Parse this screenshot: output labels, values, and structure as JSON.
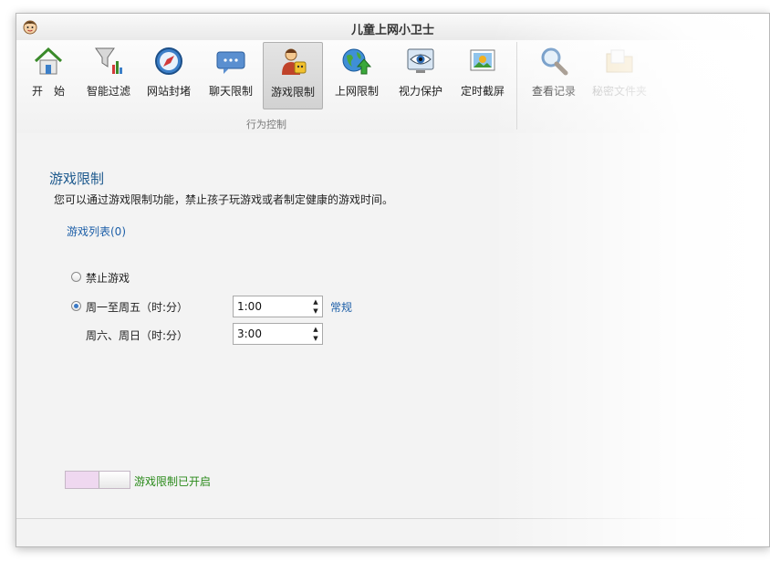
{
  "window": {
    "title": "儿童上网小卫士"
  },
  "ribbon": {
    "buttons": [
      {
        "label": "开　始",
        "icon": "house-icon"
      },
      {
        "label": "智能过滤",
        "icon": "funnel-chart-icon"
      },
      {
        "label": "网站封堵",
        "icon": "compass-icon"
      },
      {
        "label": "聊天限制",
        "icon": "chat-bubble-icon"
      },
      {
        "label": "游戏限制",
        "icon": "gamer-icon",
        "active": true
      },
      {
        "label": "上网限制",
        "icon": "globe-arrow-icon"
      },
      {
        "label": "视力保护",
        "icon": "eye-monitor-icon"
      },
      {
        "label": "定时截屏",
        "icon": "picture-icon"
      },
      {
        "label": "查看记录",
        "icon": "magnifier-icon"
      },
      {
        "label": "秘密文件夹",
        "icon": "folder-icon"
      }
    ],
    "group_label": "行为控制"
  },
  "content": {
    "title": "游戏限制",
    "description": "您可以通过游戏限制功能，禁止孩子玩游戏或者制定健康的游戏时间。",
    "game_list_link": "游戏列表(0)",
    "options": {
      "forbid_label": "禁止游戏",
      "weekday_label": "周一至周五（时:分）",
      "weekday_value": "1:00",
      "weekend_label": "周六、周日（时:分）",
      "weekend_value": "3:00",
      "normal_link": "常规",
      "selected": "weekday"
    },
    "toggle": {
      "label": "游戏限制已开启",
      "state": "on"
    }
  },
  "colors": {
    "link": "#1d5fa8",
    "title": "#1e5a8e",
    "status_on": "#2a8a1a",
    "toggle_track": "#efd8f0"
  }
}
